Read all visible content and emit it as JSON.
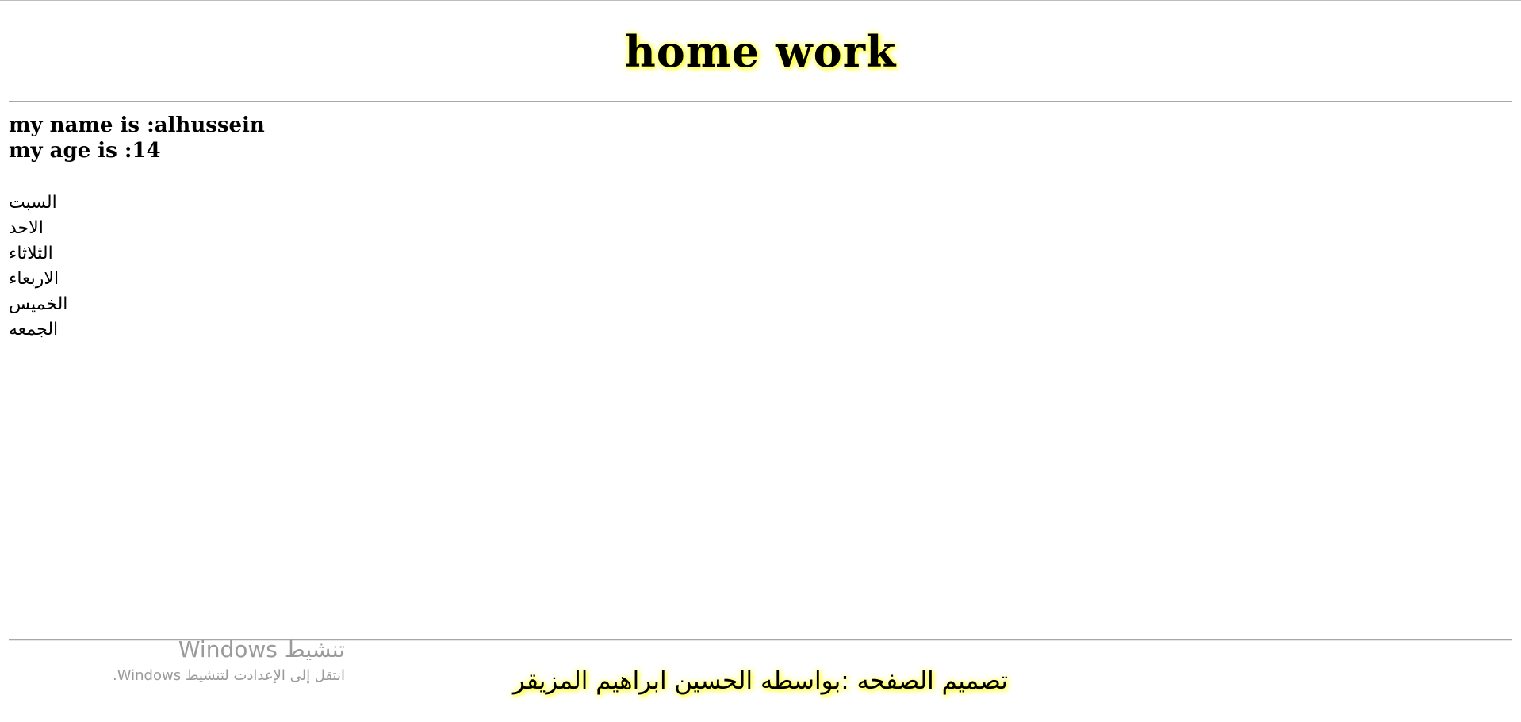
{
  "header": {
    "title": "home work"
  },
  "info": {
    "name_line": "my name is :alhussein",
    "age_line": "my age is :14"
  },
  "days": [
    "السبت",
    "الاحد",
    "الثلاثاء",
    "الاربعاء",
    "الخميس",
    "الجمعه"
  ],
  "footer": {
    "credit": "تصميم الصفحه :بواسطه الحسين ابراهيم المزيقر"
  },
  "watermark": {
    "title": "تنشيط Windows",
    "subtitle": "انتقل إلى الإعدادت لتنشيط Windows."
  },
  "colors": {
    "glow": "#ffff00",
    "rule": "#a8a8a8",
    "watermark": "#9a9a9a"
  }
}
